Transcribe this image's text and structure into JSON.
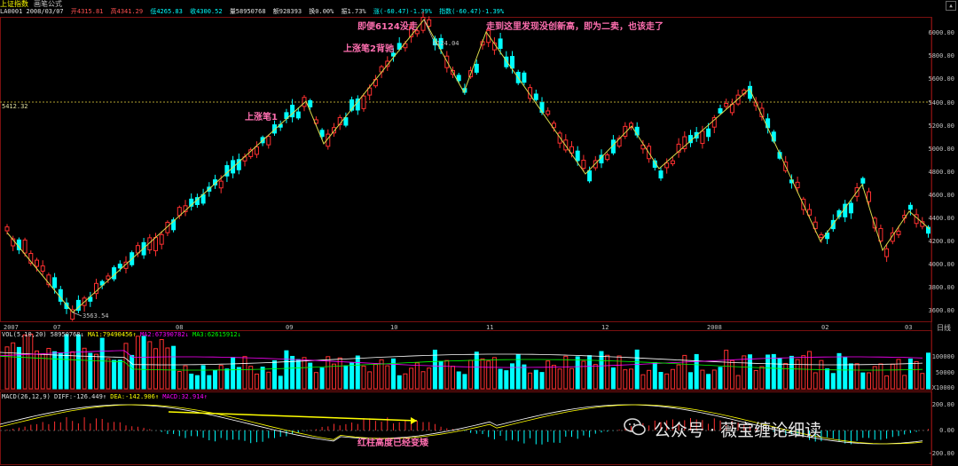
{
  "window": {
    "title": "上证指数",
    "subtitle": "画笔公式"
  },
  "info_bar": {
    "code_date": "LA0001 2008/03/07",
    "open": "开4315.81",
    "high": "高4341.29",
    "low": "低4265.83",
    "close": "收4300.52",
    "volume": "量58950768",
    "amount": "额928393",
    "turnover": "换0.00%",
    "amplitude": "振1.73%",
    "change": "涨(-60.47)-1.39%",
    "index_change": "指数(-60.47)-1.39%"
  },
  "annotations": {
    "bi1": "上涨笔1",
    "bi2": "上涨笔2背驰",
    "peak_note": "即便6124没走",
    "second_sell": "走到这里发现没创新高，即为二卖，也该走了",
    "macd_note": "红柱高度已经变矮"
  },
  "price_tags": {
    "top": "6124.04",
    "bottom": "3563.54",
    "ref_line": "5412.32"
  },
  "y_axis": [
    "6000.00",
    "5800.00",
    "5600.00",
    "5400.00",
    "5200.00",
    "5000.00",
    "4800.00",
    "4600.00",
    "4400.00",
    "4200.00",
    "4000.00",
    "3800.00",
    "3600.00"
  ],
  "x_axis": [
    "2007",
    "07",
    "08",
    "09",
    "10",
    "11",
    "12",
    "2008",
    "02",
    "03"
  ],
  "period_label": "日线",
  "volume_panel": {
    "head_left": "VOL(5,10,20)",
    "vol": "58950768↓",
    "ma1": "MA1:79490456↑",
    "ma2": "MA2:67390782↓",
    "ma3": "MA3:62615912↓",
    "y_labels": [
      "100000",
      "50000",
      "X10000"
    ]
  },
  "macd_panel": {
    "head_left": "MACD(26,12,9)",
    "diff": "DIFF:-126.449↑",
    "dea": "DEA:-142.906↑",
    "macd": "MACD:32.914↑",
    "y_labels": [
      "200.00",
      "0.00",
      "-200.00"
    ]
  },
  "watermark": {
    "text": "公众号 · 薇宝缠论细读"
  },
  "colors": {
    "up": "#ff3030",
    "down": "#00ffff",
    "bi_line": "#d8d84a",
    "annotation": "#ff6fb0",
    "ma1": "#ffffff",
    "ma2": "#ff00ff",
    "ma3": "#00ff00"
  }
}
